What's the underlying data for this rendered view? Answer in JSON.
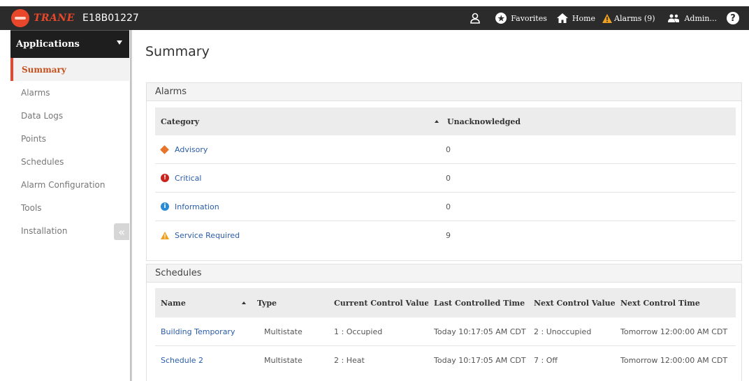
{
  "header": {
    "logo_text": "TRANE",
    "device_id": "E18B01227",
    "user_icon": "user-icon",
    "favorites_label": "Favorites",
    "home_label": "Home",
    "alarms_label": "Alarms (9)",
    "admin_label": "Admin...",
    "help_symbol": "?"
  },
  "sidebar": {
    "header_label": "Applications",
    "items": [
      {
        "label": "Summary",
        "active": true
      },
      {
        "label": "Alarms"
      },
      {
        "label": "Data Logs"
      },
      {
        "label": "Points"
      },
      {
        "label": "Schedules"
      },
      {
        "label": "Alarm Configuration"
      },
      {
        "label": "Tools"
      },
      {
        "label": "Installation"
      }
    ],
    "collapse_symbol": "«"
  },
  "main": {
    "title": "Summary",
    "alarms_panel": {
      "title": "Alarms",
      "columns": [
        "Category",
        "Unacknowledged"
      ],
      "rows": [
        {
          "category": "Advisory",
          "icon": "advisory-icon",
          "count": "0"
        },
        {
          "category": "Critical",
          "icon": "critical-icon",
          "count": "0"
        },
        {
          "category": "Information",
          "icon": "information-icon",
          "count": "0"
        },
        {
          "category": "Service Required",
          "icon": "warning-icon",
          "count": "9"
        }
      ]
    },
    "schedules_panel": {
      "title": "Schedules",
      "columns": [
        "Name",
        "Type",
        "Current Control Value",
        "Last Controlled Time",
        "Next Control Value",
        "Next Control Time"
      ],
      "rows": [
        {
          "name": "Building Temporary",
          "type": "Multistate",
          "current": "1 : Occupied",
          "last": "Today 10:17:05 AM CDT",
          "next_value": "2 : Unoccupied",
          "next_time": "Tomorrow 12:00:00 AM CDT"
        },
        {
          "name": "Schedule 2",
          "type": "Multistate",
          "current": "2 : Heat",
          "last": "Today 10:17:05 AM CDT",
          "next_value": "7 : Off",
          "next_time": "Tomorrow 12:00:00 AM CDT"
        }
      ]
    }
  },
  "colors": {
    "topbar": "#2b2b2b",
    "accent": "#e8472b",
    "link": "#2a5ca8",
    "warning": "#f0a020"
  }
}
